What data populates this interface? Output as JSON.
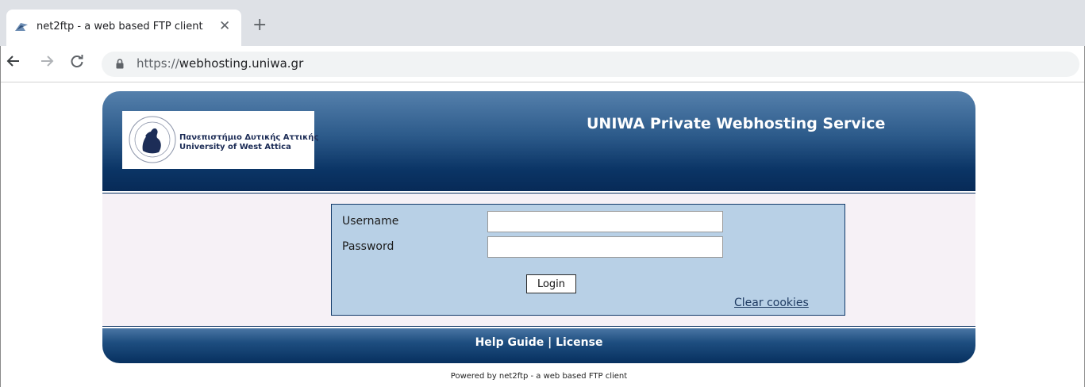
{
  "browser": {
    "tab_title": "net2ftp - a web based FTP client",
    "close_glyph": "✕",
    "new_tab_glyph": "+",
    "url_scheme": "https://",
    "url_host": "webhosting.uniwa.gr",
    "icons": {
      "back": "arrow-left",
      "forward": "arrow-right",
      "reload": "reload",
      "lock": "lock",
      "favicon": "net2ftp-favicon"
    }
  },
  "header": {
    "logo_greek": "Πανεπιστήμιο Δυτικής Αττικής",
    "logo_english": "University of West Attica",
    "title": "UNIWA Private Webhosting Service"
  },
  "login": {
    "username_label": "Username",
    "password_label": "Password",
    "username_value": "",
    "password_value": "",
    "login_button": "Login",
    "clear_cookies": "Clear cookies"
  },
  "footer": {
    "help_guide": "Help Guide",
    "separator": " | ",
    "license": "License",
    "powered_by": "Powered by net2ftp - a web based FTP client"
  },
  "colors": {
    "header_dark": "#072a57",
    "header_light": "#5580ac",
    "login_box": "#b8d0e6",
    "page_band": "#f6f1f6"
  }
}
